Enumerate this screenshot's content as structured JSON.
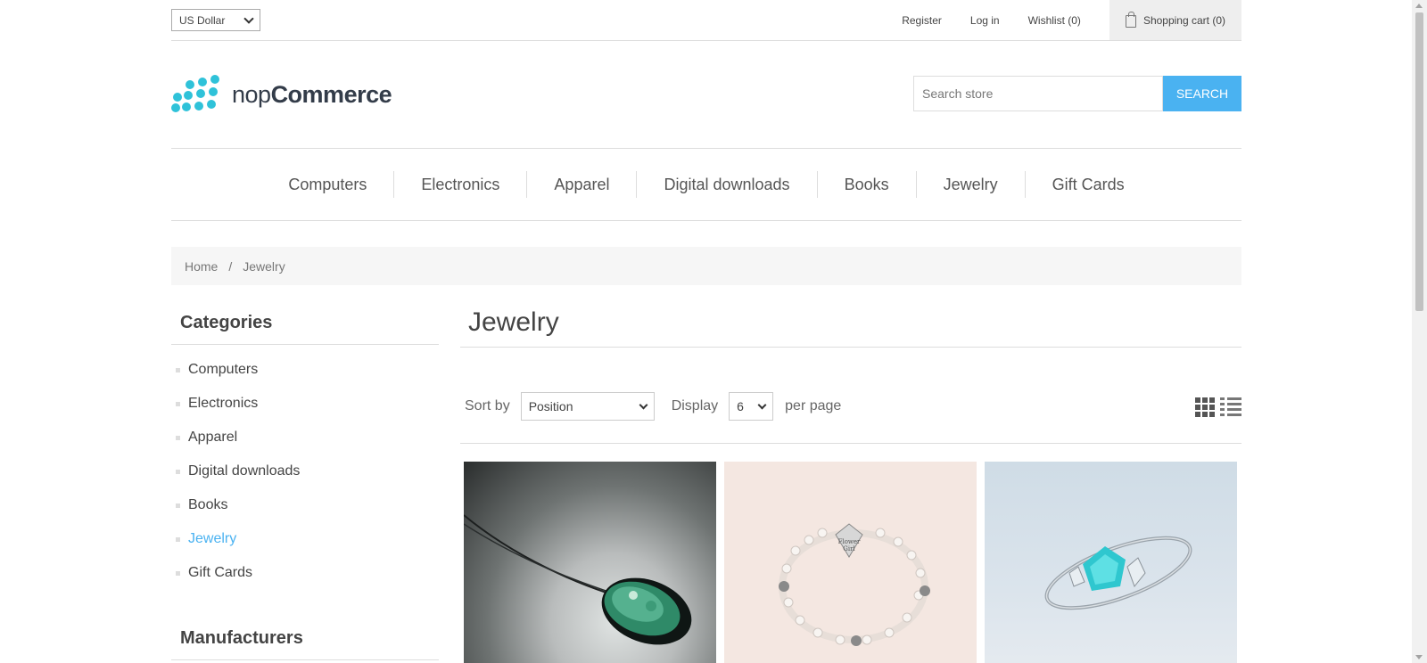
{
  "topbar": {
    "currency": "US Dollar",
    "links": {
      "register": "Register",
      "login": "Log in",
      "wishlist": "Wishlist (0)",
      "cart": "Shopping cart (0)"
    }
  },
  "logo": {
    "light": "nop",
    "bold": "Commerce"
  },
  "search": {
    "placeholder": "Search store",
    "button": "SEARCH"
  },
  "nav": {
    "items": [
      "Computers",
      "Electronics",
      "Apparel",
      "Digital downloads",
      "Books",
      "Jewelry",
      "Gift Cards"
    ]
  },
  "breadcrumb": {
    "home": "Home",
    "separator": "/",
    "current": "Jewelry"
  },
  "sidebar": {
    "categories_title": "Categories",
    "items": [
      "Computers",
      "Electronics",
      "Apparel",
      "Digital downloads",
      "Books",
      "Jewelry",
      "Gift Cards"
    ],
    "active": "Jewelry",
    "manufacturers_title": "Manufacturers"
  },
  "main": {
    "title": "Jewelry",
    "sort_label": "Sort by",
    "sort_value": "Position",
    "display_label": "Display",
    "display_value": "6",
    "per_page_label": "per page"
  },
  "colors": {
    "accent": "#4ab2f1",
    "logo": "#2fc2d9"
  }
}
